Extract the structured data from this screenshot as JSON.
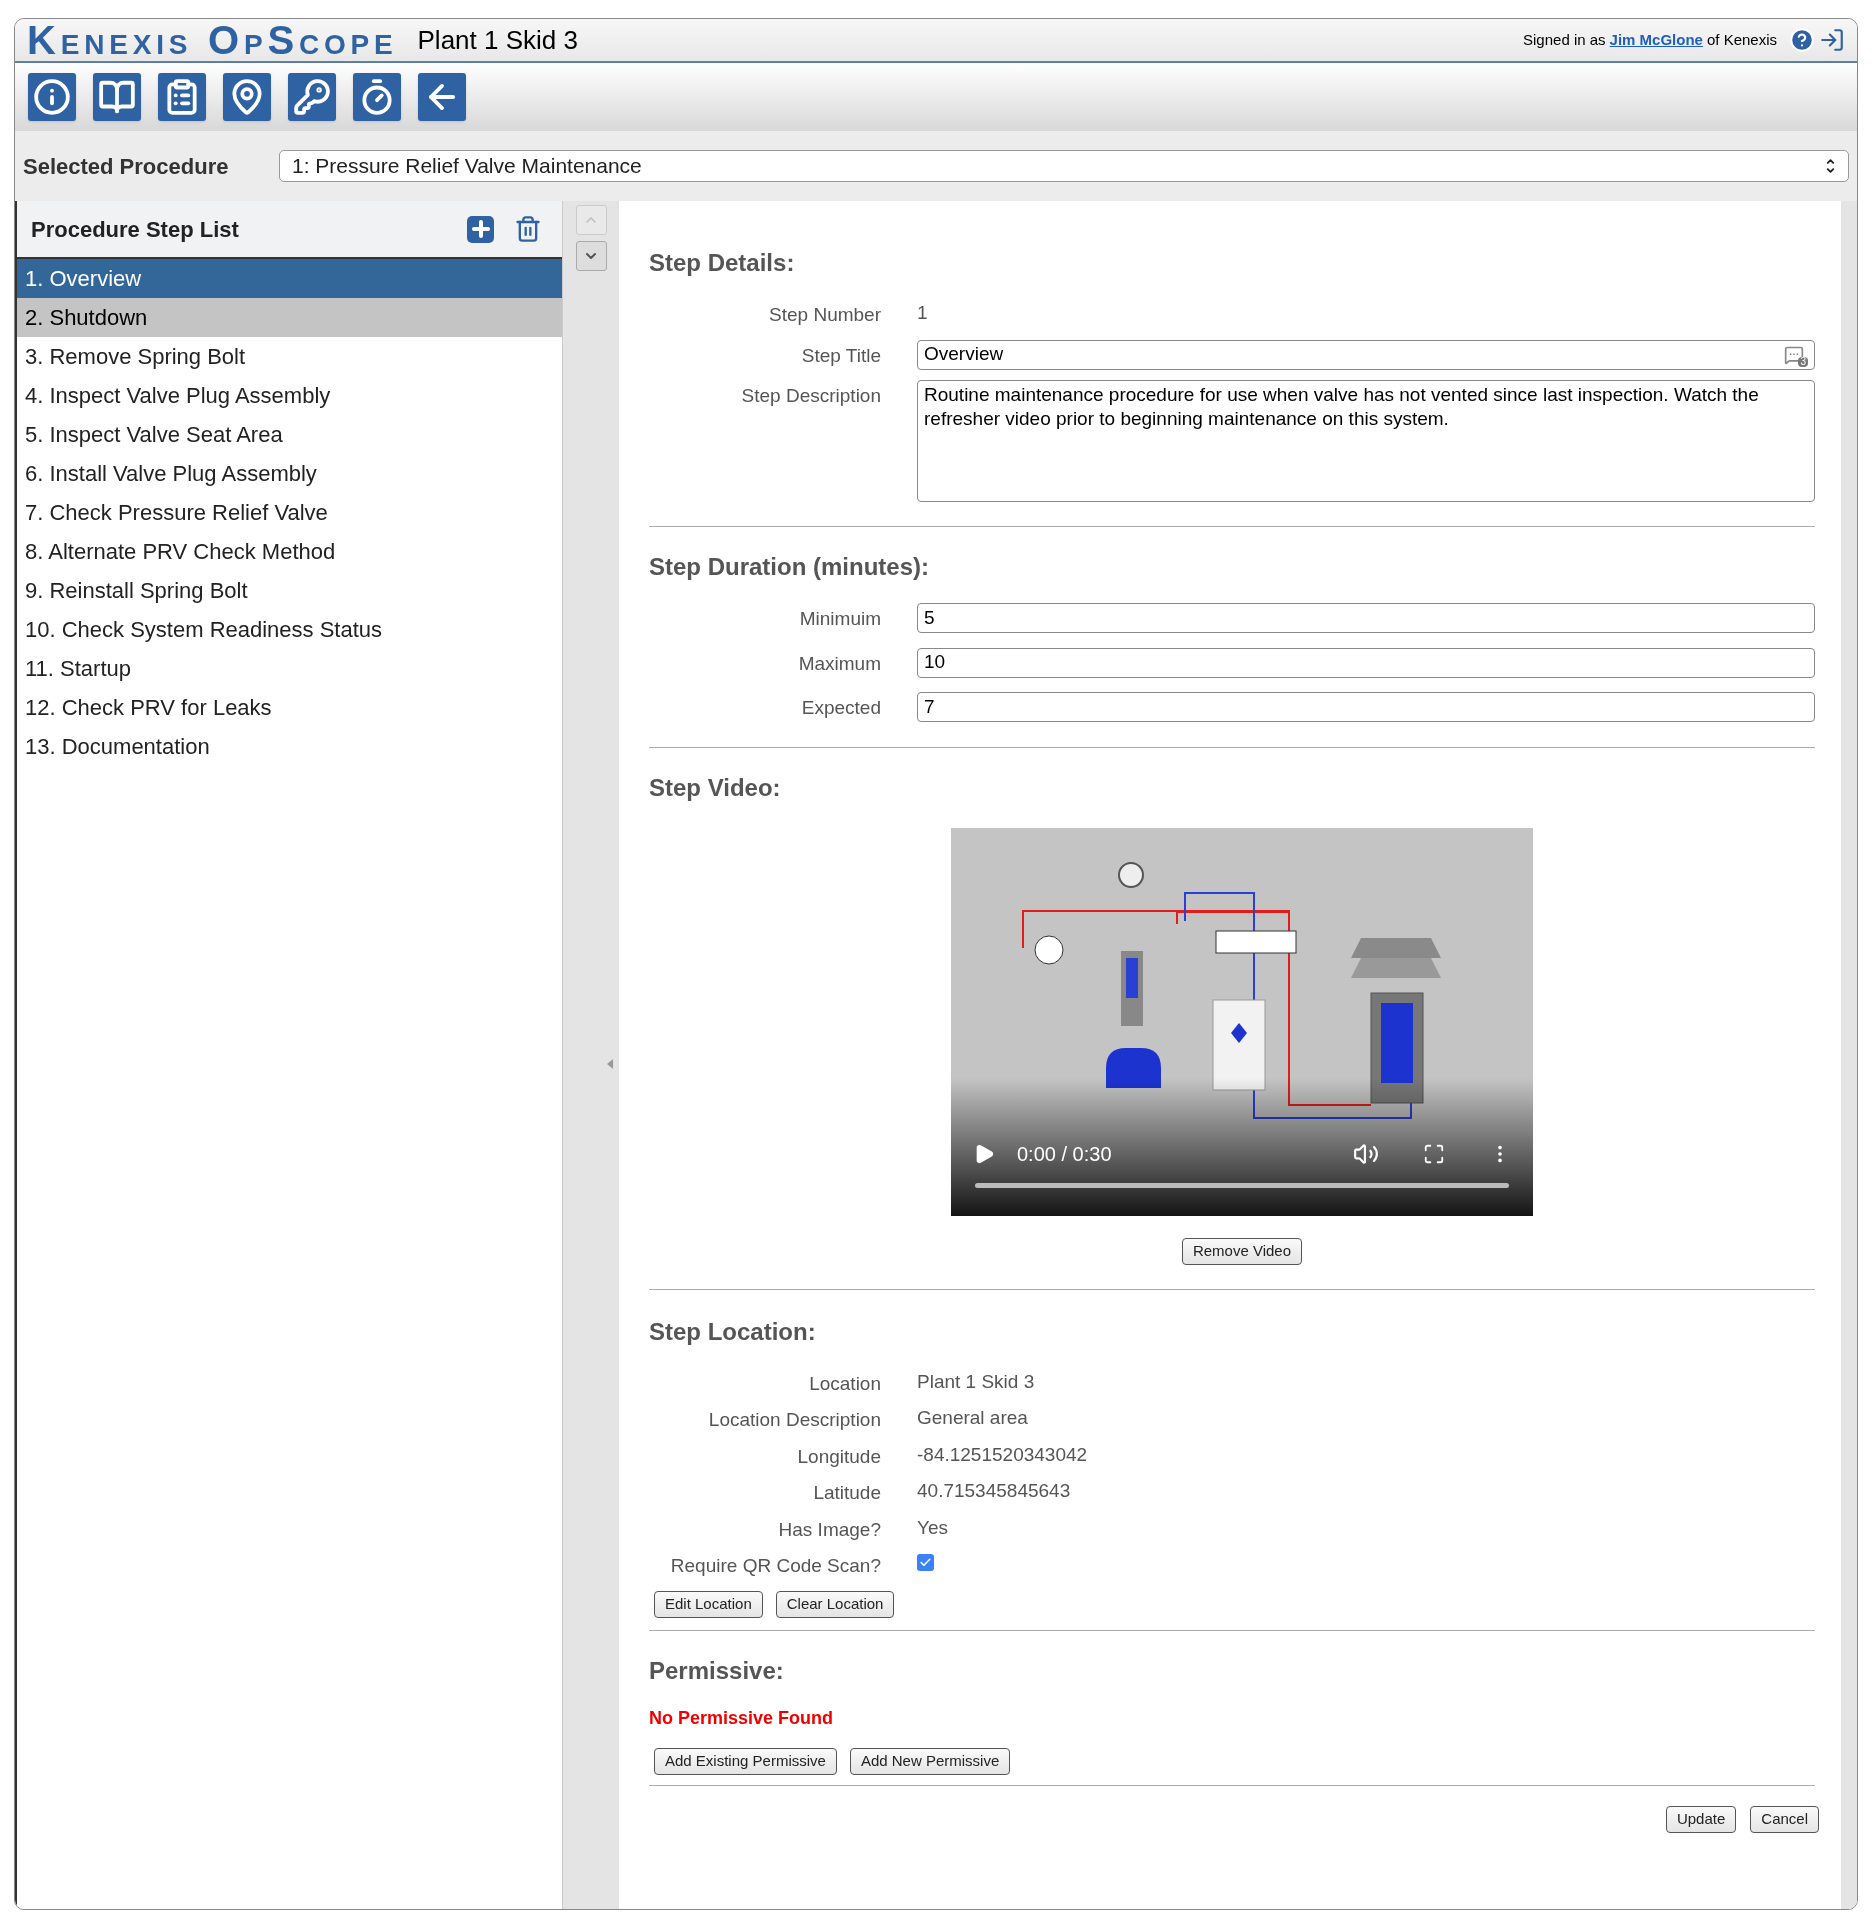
{
  "header": {
    "logo": "Kenexis OpScope",
    "location": "Plant 1 Skid 3",
    "signed_in_prefix": "Signed in as",
    "user": "Jim McGlone",
    "signed_in_suffix": "of Kenexis"
  },
  "selected_procedure": {
    "label": "Selected Procedure",
    "value": "1: Pressure Relief Valve Maintenance"
  },
  "step_list": {
    "title": "Procedure Step List",
    "items": [
      {
        "label": "1. Overview",
        "selected": true,
        "hovered": false
      },
      {
        "label": "2. Shutdown",
        "selected": false,
        "hovered": true
      },
      {
        "label": "3. Remove Spring Bolt",
        "selected": false,
        "hovered": false
      },
      {
        "label": "4. Inspect Valve Plug Assembly",
        "selected": false,
        "hovered": false
      },
      {
        "label": "5. Inspect Valve Seat Area",
        "selected": false,
        "hovered": false
      },
      {
        "label": "6. Install Valve Plug Assembly",
        "selected": false,
        "hovered": false
      },
      {
        "label": "7. Check Pressure Relief Valve",
        "selected": false,
        "hovered": false
      },
      {
        "label": "8. Alternate PRV Check Method",
        "selected": false,
        "hovered": false
      },
      {
        "label": "9. Reinstall Spring Bolt",
        "selected": false,
        "hovered": false
      },
      {
        "label": "10. Check System Readiness Status",
        "selected": false,
        "hovered": false
      },
      {
        "label": "11. Startup",
        "selected": false,
        "hovered": false
      },
      {
        "label": "12. Check PRV for Leaks",
        "selected": false,
        "hovered": false
      },
      {
        "label": "13. Documentation",
        "selected": false,
        "hovered": false
      }
    ]
  },
  "step_details": {
    "heading": "Step Details:",
    "fields": [
      {
        "kind": "text",
        "label": "Step Number",
        "value": "1"
      },
      {
        "kind": "input",
        "label": "Step Title",
        "value": "Overview",
        "badge": "3"
      },
      {
        "kind": "textarea",
        "label": "Step Description",
        "value": "Routine maintenance procedure for use when valve has not vented since last inspection. Watch the refresher video prior to beginning maintenance on this system."
      }
    ]
  },
  "step_duration": {
    "heading": "Step Duration (minutes):",
    "fields": [
      {
        "kind": "input",
        "label": "Minimuim",
        "value": "5"
      },
      {
        "kind": "input",
        "label": "Maximum",
        "value": "10"
      },
      {
        "kind": "input",
        "label": "Expected",
        "value": "7"
      }
    ]
  },
  "step_video": {
    "heading": "Step Video:",
    "time": "0:00 / 0:30",
    "remove_button": "Remove Video"
  },
  "step_location": {
    "heading": "Step Location:",
    "fields": [
      {
        "kind": "text",
        "label": "Location",
        "value": "Plant 1 Skid 3"
      },
      {
        "kind": "text",
        "label": "Location Description",
        "value": "General area"
      },
      {
        "kind": "text",
        "label": "Longitude",
        "value": "-84.1251520343042"
      },
      {
        "kind": "text",
        "label": "Latitude",
        "value": "40.715345845643"
      },
      {
        "kind": "text",
        "label": "Has Image?",
        "value": "Yes"
      },
      {
        "kind": "checkbox",
        "label": "Require QR Code Scan?",
        "checked": true
      }
    ],
    "buttons": [
      "Edit Location",
      "Clear Location"
    ]
  },
  "permissive": {
    "heading": "Permissive:",
    "message": "No Permissive Found",
    "buttons": [
      "Add Existing Permissive",
      "Add New Permissive"
    ]
  },
  "footer_buttons": [
    "Update",
    "Cancel"
  ]
}
